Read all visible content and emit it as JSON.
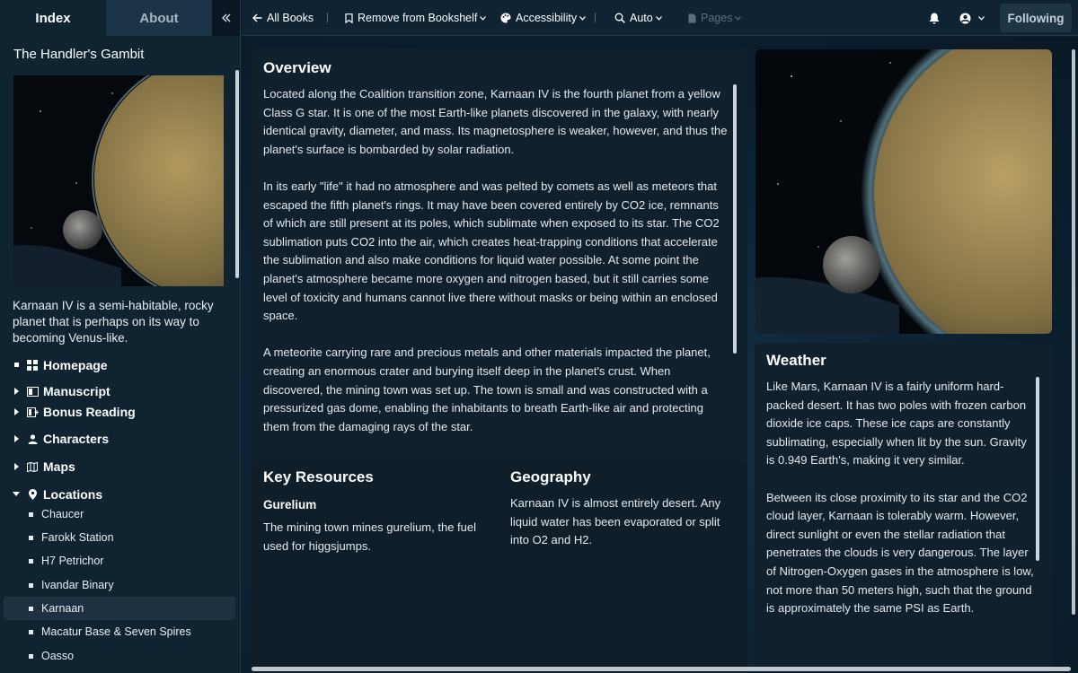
{
  "sidebar": {
    "tabs": {
      "index": "Index",
      "about": "About"
    },
    "title": "The Handler's Gambit",
    "description": "Karnaan IV is a semi-habitable, rocky planet that is perhaps on its way to becoming Venus-like.",
    "nav": [
      {
        "label": "Homepage",
        "icon": "grid-icon"
      },
      {
        "label": "Manuscript",
        "icon": "book-icon"
      },
      {
        "label": "Bonus Reading",
        "icon": "book-plus-icon"
      },
      {
        "label": "Characters",
        "icon": "person-icon"
      },
      {
        "label": "Maps",
        "icon": "map-icon"
      },
      {
        "label": "Locations",
        "icon": "map-pin-icon"
      }
    ],
    "locations": [
      "Chaucer",
      "Farokk Station",
      "H7 Petrichor",
      "Ivandar Binary",
      "Karnaan",
      "Macatur Base & Seven Spires",
      "Oasso"
    ],
    "selected_location": "Karnaan"
  },
  "topbar": {
    "all_books": "All Books",
    "remove_bookshelf": "Remove from Bookshelf",
    "accessibility": "Accessibility",
    "auto": "Auto",
    "pages": "Pages",
    "following": "Following"
  },
  "overview": {
    "title": "Overview",
    "p1": "Located along the Coalition transition zone, Karnaan IV is the fourth planet from a yellow Class G star. It is one of the most Earth-like planets discovered in the galaxy, with nearly identical gravity, diameter, and mass. Its magnetosphere is weaker, however, and thus the planet's surface is bombarded by solar radiation.",
    "p2": "In its early \"life\" it had no atmosphere and was pelted by comets as well as meteors that escaped the fifth planet's rings. It may have been covered entirely by CO2 ice, remnants of which are still present at its poles, which sublimate when exposed to its star. The CO2 sublimation puts CO2 into the air, which creates heat-trapping conditions that accelerate the sublimation and also make conditions for liquid water possible. At some point the planet's atmosphere became more oxygen and nitrogen based, but it still carries some level of toxicity and humans cannot live there without masks or being within an enclosed space.",
    "p3": "A meteorite carrying rare and precious metals and other materials impacted the planet, creating an enormous crater and burying itself deep in the planet's crust. When discovered, the mining town was set up. The town is small and was constructed with a pressurized gas dome, enabling the inhabitants to breath Earth-like air and protecting them from the damaging rays of the star."
  },
  "key_resources": {
    "title": "Key Resources",
    "subtitle": "Gurelium",
    "text": "The mining town mines gurelium, the fuel used for higgsjumps."
  },
  "geography": {
    "title": "Geography",
    "text": "Karnaan IV is almost entirely desert. Any liquid water has been evaporated or split into O2 and H2."
  },
  "weather": {
    "title": "Weather",
    "p1": "Like Mars, Karnaan IV is a fairly uniform hard-packed desert. It has two poles with frozen carbon dioxide ice caps. These ice caps are constantly sublimating, especially when lit by the sun. Gravity is 0.949 Earth's, making it very similar.",
    "p2": "Between its close proximity to its star and the CO2 cloud layer, Karnaan is tolerably warm. However, direct sunlight or even the stellar radiation that penetrates the clouds is very dangerous. The layer of Nitrogen-Oxygen gases in the atmosphere is low, not more than 50 meters high, such that the ground is approximately the same PSI as Earth."
  },
  "colors": {
    "background": "#0c1d2a",
    "sidebar": "#0f2331",
    "card": "#10202c",
    "text": "#e3e9ee"
  }
}
